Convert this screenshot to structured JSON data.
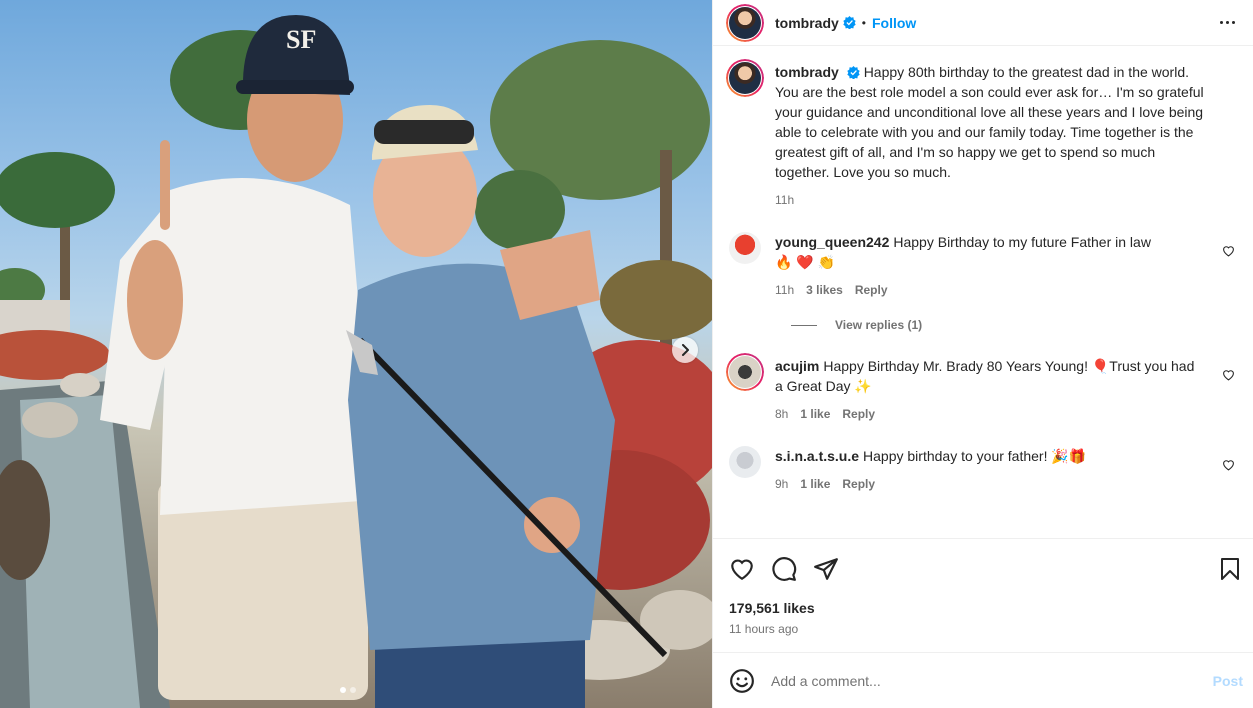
{
  "post": {
    "username": "tombrady",
    "follow_label": "Follow",
    "separator": "•",
    "likes": "179,561 likes",
    "time_ago": "11 hours ago"
  },
  "caption": {
    "username": "tombrady",
    "text": "Happy 80th birthday to the greatest dad in the world. You are the best role model a son could ever ask for… I'm so grateful your guidance and unconditional love all these years and I love being able to celebrate with you and our family today. Time together is the greatest gift of all, and I'm so happy we get to spend so much together. Love you so much.",
    "time": "11h"
  },
  "comments": [
    {
      "username": "young_queen242",
      "text": "Happy Birthday to my future Father in law",
      "emoji": "🔥 ❤️ 👏",
      "time": "11h",
      "likes": "3 likes",
      "reply_label": "Reply",
      "view_replies": "View replies (1)"
    },
    {
      "username": "acujim",
      "text": "Happy Birthday Mr. Brady 80 Years Young! 🎈Trust you had a Great Day ✨",
      "time": "8h",
      "likes": "1 like",
      "reply_label": "Reply"
    },
    {
      "username": "s.i.n.a.t.s.u.e",
      "text": "Happy birthday to your father! 🎉🎁",
      "time": "9h",
      "likes": "1 like",
      "reply_label": "Reply"
    }
  ],
  "comment_box": {
    "placeholder": "Add a comment...",
    "post_label": "Post"
  },
  "colors": {
    "accent": "#0095f6",
    "post_disabled": "#b3dbff",
    "muted": "#737373"
  },
  "icons": [
    "verified-badge-icon",
    "more-options-icon",
    "heart-icon",
    "comment-icon",
    "share-icon",
    "bookmark-icon",
    "emoji-icon",
    "next-arrow-icon"
  ]
}
